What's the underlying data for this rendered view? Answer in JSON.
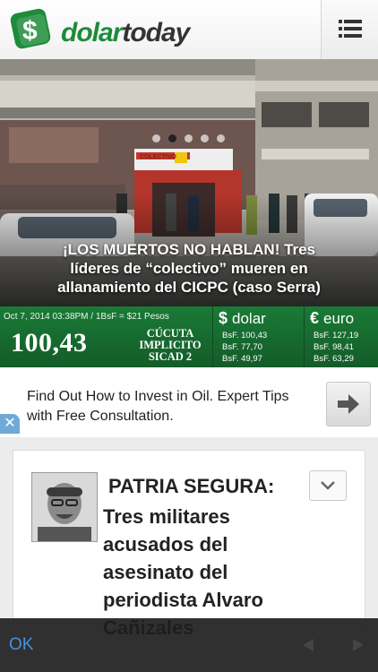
{
  "header": {
    "brand_part1": "dolar",
    "brand_part2": "today"
  },
  "hero": {
    "headline_lines": [
      "¡LOS MUERTOS NO HABLAN! Tres",
      "líderes de “colectivo” mueren en",
      "allanamiento del CICPC (caso Serra)"
    ],
    "storefront_sign": "COLECTIVO",
    "slides_total": 5,
    "active_slide": 2
  },
  "ticker": {
    "date_line": "Oct 7, 2014 03:38PM / 1BsF = $21 Pesos",
    "main_rate": "100,43",
    "city_lines": [
      "CÚCUTA",
      "IMPLICITO",
      "SICAD 2"
    ],
    "dolar": {
      "symbol": "$",
      "label": "dolar",
      "rates": [
        "BsF. 100,43",
        "BsF. 77,70",
        "BsF. 49,97"
      ]
    },
    "euro": {
      "symbol": "€",
      "label": "euro",
      "rates": [
        "BsF. 127,19",
        "BsF. 98,41",
        "BsF. 63,29"
      ]
    }
  },
  "ad": {
    "text": "Find Out How to Invest in Oil. Expert Tips with Free Consultation.",
    "close_label": "✕"
  },
  "article": {
    "title_first": "PATRIA SEGURA:",
    "title_rest": "Tres militares acusados del asesinato del periodista Alvaro Cañizales"
  },
  "bottom_bar": {
    "ok_label": "OK"
  },
  "colors": {
    "brand_green": "#1e8b3a",
    "ticker_green": "#1a7a36",
    "ok_blue": "#4a90e2",
    "ad_close_blue": "#6fa9d6"
  },
  "icons": {
    "menu": "menu-list-icon",
    "ad_arrow": "arrow-right-icon",
    "chevron": "chevron-down-icon",
    "back": "triangle-left-icon",
    "forward": "triangle-right-icon"
  }
}
